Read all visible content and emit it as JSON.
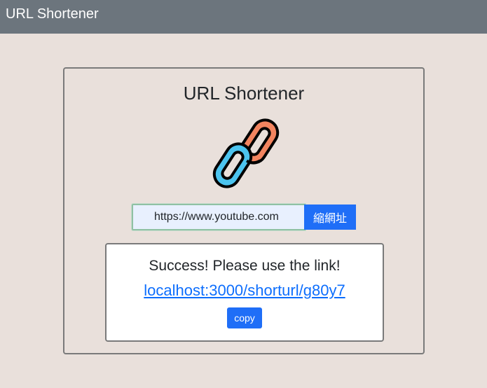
{
  "navbar": {
    "brand": "URL Shortener"
  },
  "card": {
    "title": "URL Shortener",
    "logo_icon": "link-chain-icon"
  },
  "form": {
    "url_value": "https://www.youtube.com",
    "submit_label": "縮網址"
  },
  "result": {
    "message": "Success! Please use the link!",
    "short_url": "localhost:3000/shorturl/g80y7",
    "copy_label": "copy"
  },
  "colors": {
    "navbar": "#6c757d",
    "background": "#e9e0db",
    "primary": "#1f6ef7",
    "link": "#0d6efd",
    "chain_orange": "#f2845f",
    "chain_blue": "#4cc4ef"
  }
}
